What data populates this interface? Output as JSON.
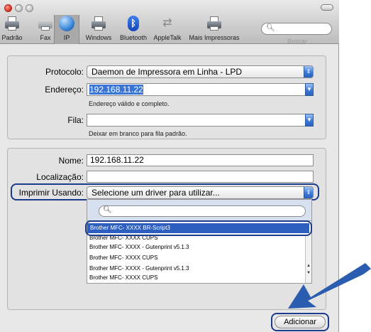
{
  "toolbar": {
    "items": [
      {
        "label": "Padrão",
        "icon": "printer-icon"
      },
      {
        "label": "Fax",
        "icon": "fax-icon"
      },
      {
        "label": "IP",
        "icon": "globe-icon"
      },
      {
        "label": "Windows",
        "icon": "windows-printer-icon"
      },
      {
        "label": "Bluetooth",
        "icon": "bluetooth-icon"
      },
      {
        "label": "AppleTalk",
        "icon": "appletalk-icon"
      },
      {
        "label": "Mais Impressoras",
        "icon": "more-printers-icon"
      }
    ],
    "search_label": "Buscar"
  },
  "protocol_section": {
    "protocol_label": "Protocolo:",
    "protocol_value": "Daemon de Impressora em Linha - LPD",
    "address_label": "Endereço:",
    "address_value": "192.168.11.22",
    "address_hint": "Endereço válido e completo.",
    "queue_label": "Fila:",
    "queue_value": "",
    "queue_hint": "Deixar em branco para fila padrão."
  },
  "details_section": {
    "name_label": "Nome:",
    "name_value": "192.168.11.22",
    "location_label": "Localização:",
    "location_value": "",
    "print_using_label": "Imprimir Usando:",
    "print_using_value": "Selecione um driver para utilizar..."
  },
  "driver_list": {
    "selected": "Brother MFC- XXXX BR-Script3",
    "items": [
      "Brother MFC- XXXX CUPS",
      "Brother MFC- XXXX - Gutenprint v5.1.3",
      "Brother MFC- XXXX CUPS",
      "Brother MFC- XXXX - Gutenprint v5.1.3",
      "Brother MFC- XXXX CUPS"
    ]
  },
  "add_button": "Adicionar",
  "colors": {
    "callout": "#1c3b8a",
    "selection": "#2d5fc0",
    "arrow": "#2a5db0"
  }
}
